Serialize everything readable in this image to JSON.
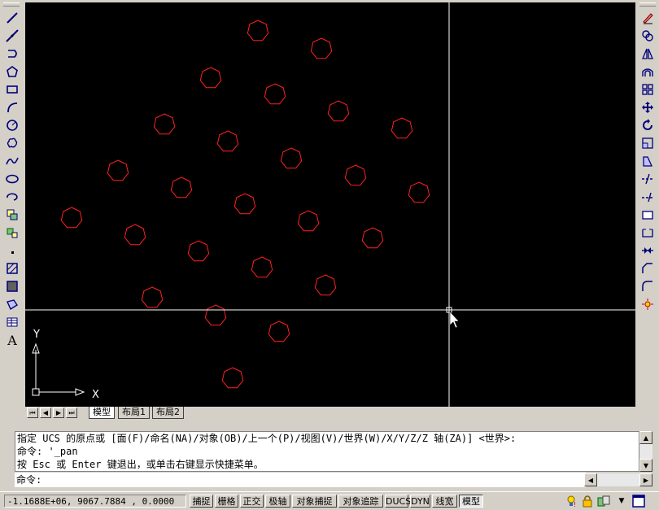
{
  "left_toolbar": {
    "tools": [
      {
        "name": "line-icon"
      },
      {
        "name": "construction-line-icon"
      },
      {
        "name": "polyline-icon"
      },
      {
        "name": "polygon-icon"
      },
      {
        "name": "rectangle-icon"
      },
      {
        "name": "arc-icon"
      },
      {
        "name": "circle-icon"
      },
      {
        "name": "revision-cloud-icon"
      },
      {
        "name": "spline-icon"
      },
      {
        "name": "ellipse-icon"
      },
      {
        "name": "ellipse-arc-icon"
      },
      {
        "name": "insert-block-icon"
      },
      {
        "name": "make-block-icon"
      },
      {
        "name": "point-icon"
      },
      {
        "name": "hatch-icon"
      },
      {
        "name": "gradient-icon"
      },
      {
        "name": "region-icon"
      },
      {
        "name": "table-icon"
      },
      {
        "name": "multiline-text-icon",
        "label": "A"
      }
    ]
  },
  "right_toolbar": {
    "tools": [
      {
        "name": "erase-icon"
      },
      {
        "name": "copy-icon"
      },
      {
        "name": "mirror-icon"
      },
      {
        "name": "offset-icon"
      },
      {
        "name": "array-icon"
      },
      {
        "name": "move-icon"
      },
      {
        "name": "rotate-icon"
      },
      {
        "name": "scale-icon"
      },
      {
        "name": "stretch-icon"
      },
      {
        "name": "trim-icon"
      },
      {
        "name": "extend-icon"
      },
      {
        "name": "break-at-point-icon"
      },
      {
        "name": "break-icon"
      },
      {
        "name": "join-icon"
      },
      {
        "name": "chamfer-icon"
      },
      {
        "name": "fillet-icon"
      },
      {
        "name": "explode-icon"
      }
    ]
  },
  "drawing": {
    "background": "#000000",
    "entity_color": "#ff2020",
    "ucs_labels": {
      "x": "X",
      "y": "Y"
    }
  },
  "layout_tabs": {
    "nav_buttons": [
      "⏮",
      "◀",
      "▶",
      "⏭"
    ],
    "tabs": [
      {
        "label": "模型",
        "active": true
      },
      {
        "label": "布局1",
        "active": false
      },
      {
        "label": "布局2",
        "active": false
      }
    ]
  },
  "command": {
    "history": [
      "指定 UCS 的原点或 [面(F)/命名(NA)/对象(OB)/上一个(P)/视图(V)/世界(W)/X/Y/Z/Z 轴(ZA)] <世界>:",
      "命令: '_pan",
      "按 Esc 或 Enter 键退出，或单击右键显示快捷菜单。"
    ],
    "prompt": "命令:"
  },
  "status": {
    "coordinates": "-1.1688E+06, 9067.7884 , 0.0000",
    "toggles": [
      {
        "label": "捕捉",
        "on": false
      },
      {
        "label": "栅格",
        "on": false
      },
      {
        "label": "正交",
        "on": false
      },
      {
        "label": "极轴",
        "on": false
      },
      {
        "label": "对象捕捉",
        "on": false
      },
      {
        "label": "对象追踪",
        "on": false
      },
      {
        "label": "DUCS",
        "on": false
      },
      {
        "label": "DYN",
        "on": false
      },
      {
        "label": "线宽",
        "on": false
      },
      {
        "label": "模型",
        "on": true
      }
    ],
    "tray_icons": [
      "communication-center-icon",
      "lock-icon",
      "tray-settings-icon",
      "dropdown-arrow-icon",
      "clean-screen-icon"
    ]
  }
}
